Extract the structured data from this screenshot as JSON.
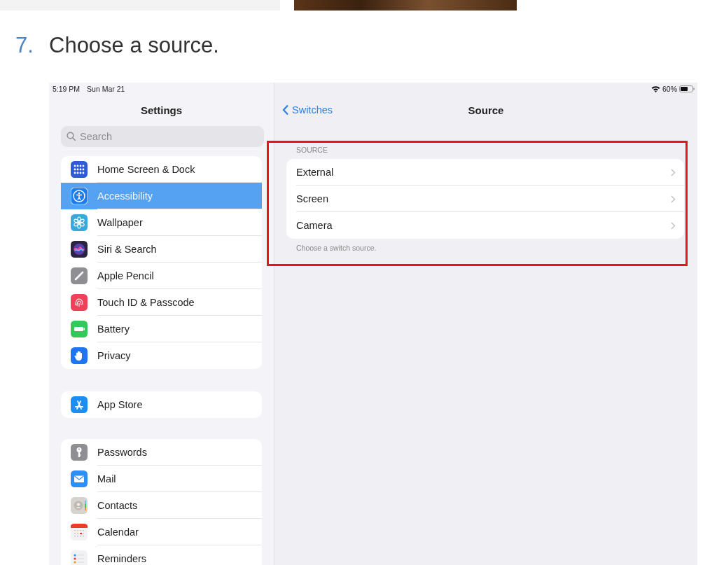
{
  "step": {
    "number": "7.",
    "text": "Choose a source."
  },
  "status_bar": {
    "time": "5:19 PM",
    "date": "Sun Mar 21",
    "battery": "60%"
  },
  "sidebar": {
    "title": "Settings",
    "search": {
      "placeholder": "Search"
    },
    "groups": [
      {
        "items": [
          {
            "label": "Home Screen & Dock",
            "color": "#2f5bd6",
            "selected": false
          },
          {
            "label": "Accessibility",
            "color": "#1a7cf0",
            "selected": true
          },
          {
            "label": "Wallpaper",
            "color": "#39a9dc",
            "selected": false
          },
          {
            "label": "Siri & Search",
            "color": "#2b2340",
            "selected": false
          },
          {
            "label": "Apple Pencil",
            "color": "#8e8e93",
            "selected": false
          },
          {
            "label": "Touch ID & Passcode",
            "color": "#f0405a",
            "selected": false
          },
          {
            "label": "Battery",
            "color": "#34c759",
            "selected": false
          },
          {
            "label": "Privacy",
            "color": "#1f74f0",
            "selected": false
          }
        ]
      },
      {
        "items": [
          {
            "label": "App Store",
            "color": "#1c8ef2",
            "selected": false
          }
        ]
      },
      {
        "items": [
          {
            "label": "Passwords",
            "color": "#8e8e93",
            "selected": false
          },
          {
            "label": "Mail",
            "color": "#2d8ef5",
            "selected": false
          },
          {
            "label": "Contacts",
            "color": "#d6d3ce",
            "selected": false
          },
          {
            "label": "Calendar",
            "color": "#f2f2f4",
            "selected": false
          },
          {
            "label": "Reminders",
            "color": "#f2f2f4",
            "selected": false
          }
        ]
      }
    ]
  },
  "detail": {
    "back": "Switches",
    "title": "Source",
    "section": {
      "header": "SOURCE",
      "rows": [
        {
          "label": "External"
        },
        {
          "label": "Screen"
        },
        {
          "label": "Camera"
        }
      ],
      "footer": "Choose a switch source."
    }
  }
}
